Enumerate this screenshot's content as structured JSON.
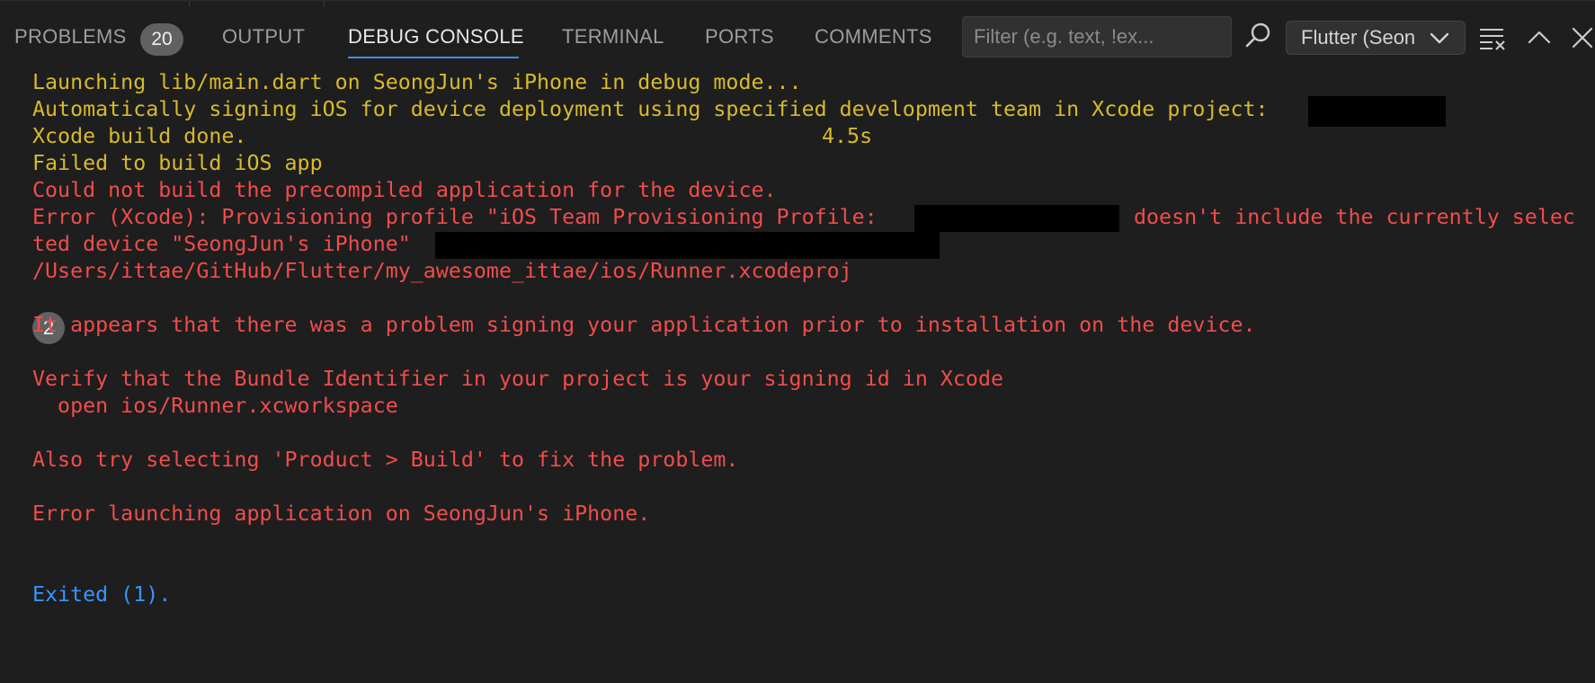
{
  "panel": {
    "tabs": [
      {
        "label": "PROBLEMS",
        "badge": "20"
      },
      {
        "label": "OUTPUT"
      },
      {
        "label": "DEBUG CONSOLE",
        "active": true
      },
      {
        "label": "TERMINAL"
      },
      {
        "label": "PORTS"
      },
      {
        "label": "COMMENTS"
      }
    ],
    "filter_placeholder": "Filter (e.g. text, !ex...",
    "session_select": "Flutter (Seon",
    "icons": [
      "search-icon",
      "chevron-down-icon",
      "clear-console-icon",
      "chevron-up-icon",
      "close-icon"
    ]
  },
  "console": {
    "lines": [
      {
        "text": "Launching lib/main.dart on SeongJun's iPhone in debug mode...",
        "color": "yellow"
      },
      {
        "text": "Automatically signing iOS for device deployment using specified development team in Xcode project:",
        "color": "yellow"
      },
      {
        "text": "Xcode build done.",
        "color": "yellow"
      },
      {
        "text": "4.5s",
        "color": "yellow"
      },
      {
        "text": "Failed to build iOS app",
        "color": "yellow"
      },
      {
        "text": "Could not build the precompiled application for the device.",
        "color": "red"
      },
      {
        "text": "Error (Xcode): Provisioning profile \"iOS Team Provisioning Profile:",
        "color": "red"
      },
      {
        "text": "doesn't include the currently selec",
        "color": "red"
      },
      {
        "text": "ted device \"SeongJun's iPhone\"",
        "color": "red"
      },
      {
        "text": "/Users/ittae/GitHub/Flutter/my_awesome_ittae/ios/Runner.xcodeproj",
        "color": "red"
      },
      {
        "text": "It appears that there was a problem signing your application prior to installation on the device.",
        "color": "red"
      },
      {
        "text": "Verify that the Bundle Identifier in your project is your signing id in Xcode",
        "color": "red"
      },
      {
        "text": "  open ios/Runner.xcworkspace",
        "color": "red"
      },
      {
        "text": "Also try selecting 'Product > Build' to fix the problem.",
        "color": "red"
      },
      {
        "text": "Error launching application on SeongJun's iPhone.",
        "color": "red"
      },
      {
        "text": "Exited (1).",
        "color": "blue"
      }
    ],
    "repeat_count": "2"
  },
  "colors": {
    "background": "#1e1e1e",
    "yellow": "#d7ba2b",
    "red": "#f14c4c",
    "blue": "#3794ff",
    "active_tab_underline": "#3b8eea"
  }
}
